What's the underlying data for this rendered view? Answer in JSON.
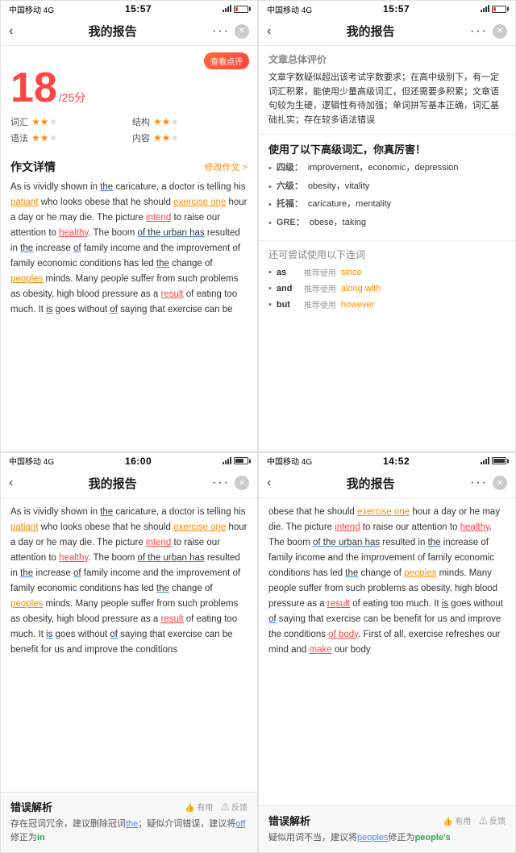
{
  "panels": [
    {
      "id": "top-left",
      "statusBar": {
        "carrier": "中国移动 4G",
        "time": "15:57",
        "battery": "low"
      },
      "navTitle": "我的报告",
      "reviewBtn": "查看点评",
      "score": {
        "number": "18",
        "total": "/25分",
        "items": [
          {
            "label": "词汇",
            "stars": 2,
            "max": 3
          },
          {
            "label": "结构",
            "stars": 2,
            "max": 3
          },
          {
            "label": "语法",
            "stars": 2,
            "max": 3
          },
          {
            "label": "内容",
            "stars": 2,
            "max": 3
          }
        ]
      },
      "essayTitle": "作文详情",
      "essayLink": "修改作文 >",
      "essayText": [
        {
          "text": "As is vividly shown in ",
          "style": "normal"
        },
        {
          "text": "the",
          "style": "underline-blue"
        },
        {
          "text": " caricature, a doctor is telling his ",
          "style": "normal"
        },
        {
          "text": "patiant",
          "style": "underline-orange"
        },
        {
          "text": " who looks obese that he should ",
          "style": "normal"
        },
        {
          "text": "exercise one",
          "style": "underline-orange"
        },
        {
          "text": " hour a day or he may die. The picture ",
          "style": "normal"
        },
        {
          "text": "intend",
          "style": "underline-red"
        },
        {
          "text": " to raise our attention to ",
          "style": "normal"
        },
        {
          "text": "healthy",
          "style": "underline-red"
        },
        {
          "text": ". The boom ",
          "style": "normal"
        },
        {
          "text": "of the urban has",
          "style": "underline-blue"
        },
        {
          "text": " resulted in ",
          "style": "normal"
        },
        {
          "text": "the",
          "style": "underline-blue"
        },
        {
          "text": " increase ",
          "style": "normal"
        },
        {
          "text": "of",
          "style": "underline-blue"
        },
        {
          "text": " family income and the improvement of family economic conditions has led ",
          "style": "normal"
        },
        {
          "text": "the",
          "style": "underline-blue"
        },
        {
          "text": " change of ",
          "style": "normal"
        },
        {
          "text": "peoples",
          "style": "underline-orange"
        },
        {
          "text": " minds. Many people suffer from such problems as obesity, high blood pressure as a ",
          "style": "normal"
        },
        {
          "text": "result",
          "style": "underline-red"
        },
        {
          "text": " of eating too much. It ",
          "style": "normal"
        },
        {
          "text": "is",
          "style": "underline-blue"
        },
        {
          "text": " goes without ",
          "style": "normal"
        },
        {
          "text": "of",
          "style": "underline-blue"
        },
        {
          "text": " saying that exercise can be",
          "style": "normal"
        }
      ]
    },
    {
      "id": "top-right",
      "statusBar": {
        "carrier": "中国移动 4G",
        "time": "15:57",
        "battery": "low"
      },
      "navTitle": "我的报告",
      "evalTitle": "文章总体评价",
      "evalText": "文章字数疑似超出该考试字数要求；在高中级别下，有一定词汇积累，能使用少量高级词汇，但还需要多积累；文章语句较为生硬，逻辑性有待加强；单词拼写基本正确，词汇基础扎实；存在较多语法错误",
      "vocabTitle": "使用了以下高级词汇，你真厉害！",
      "vocabItems": [
        {
          "level": "四级：",
          "words": "improvement，economic，depression"
        },
        {
          "level": "六级：",
          "words": "obesity，vitality"
        },
        {
          "level": "托福：",
          "words": "caricature，mentality"
        },
        {
          "level": "GRE：",
          "words": "obese，taking"
        }
      ],
      "conjTitle": "还可尝试使用以下连词",
      "conjItems": [
        {
          "word": "as",
          "label": "推荐使用",
          "suggest": "since"
        },
        {
          "word": "and",
          "label": "推荐使用",
          "suggest": "along with"
        },
        {
          "word": "but",
          "label": "推荐使用",
          "suggest": "however"
        }
      ]
    },
    {
      "id": "bottom-left",
      "statusBar": {
        "carrier": "中国移动 4G",
        "time": "16:00",
        "battery": "med"
      },
      "navTitle": "我的报告",
      "essayText": [
        {
          "text": "As is vividly shown in ",
          "style": "normal"
        },
        {
          "text": "the",
          "style": "underline-blue"
        },
        {
          "text": " caricature, a doctor is telling his ",
          "style": "normal"
        },
        {
          "text": "patiant",
          "style": "underline-orange"
        },
        {
          "text": " who looks obese that he should ",
          "style": "normal"
        },
        {
          "text": "exercise one",
          "style": "underline-orange"
        },
        {
          "text": " hour a day or he may die. The picture ",
          "style": "normal"
        },
        {
          "text": "intend",
          "style": "underline-red"
        },
        {
          "text": " to raise our attention to ",
          "style": "normal"
        },
        {
          "text": "healthy",
          "style": "underline-red"
        },
        {
          "text": ". The boom ",
          "style": "normal"
        },
        {
          "text": "of the urban has",
          "style": "underline-blue"
        },
        {
          "text": " resulted in ",
          "style": "normal"
        },
        {
          "text": "the",
          "style": "underline-blue"
        },
        {
          "text": " increase ",
          "style": "normal"
        },
        {
          "text": "of",
          "style": "underline-blue"
        },
        {
          "text": " family income and the improvement of family economic conditions has led ",
          "style": "normal"
        },
        {
          "text": "the",
          "style": "underline-blue"
        },
        {
          "text": " change of ",
          "style": "normal"
        },
        {
          "text": "peoples",
          "style": "underline-orange"
        },
        {
          "text": " minds. Many people suffer from such problems as obesity, high blood pressure as a ",
          "style": "normal"
        },
        {
          "text": "result",
          "style": "underline-red"
        },
        {
          "text": " of eating too much. It ",
          "style": "normal"
        },
        {
          "text": "is",
          "style": "underline-blue"
        },
        {
          "text": " goes without ",
          "style": "normal"
        },
        {
          "text": "of",
          "style": "underline-blue"
        },
        {
          "text": " saying that exercise can be benefit for us and improve the conditions",
          "style": "normal"
        }
      ],
      "errorTitle": "错误解析",
      "errorActions": [
        "👍 有用",
        "⚠ 反馈"
      ],
      "errorText": "存在冠词冗余，建议删除冠词the；疑似介词错误，建议将off修正为in"
    },
    {
      "id": "bottom-right",
      "statusBar": {
        "carrier": "中国移动 4G",
        "time": "14:52",
        "battery": "full"
      },
      "navTitle": "我的报告",
      "essayText": [
        {
          "text": "obese that he should ",
          "style": "normal"
        },
        {
          "text": "exercise one",
          "style": "underline-orange"
        },
        {
          "text": " hour a day or he may die. The picture ",
          "style": "normal"
        },
        {
          "text": "intend",
          "style": "underline-red"
        },
        {
          "text": " to raise our attention to ",
          "style": "normal"
        },
        {
          "text": "healthy",
          "style": "underline-red"
        },
        {
          "text": ". The boom ",
          "style": "normal"
        },
        {
          "text": "of the urban has",
          "style": "underline-blue"
        },
        {
          "text": " resulted in ",
          "style": "normal"
        },
        {
          "text": "the",
          "style": "underline-blue"
        },
        {
          "text": " increase of family income and the improvement of family economic conditions has led ",
          "style": "normal"
        },
        {
          "text": "the",
          "style": "underline-blue"
        },
        {
          "text": " change of ",
          "style": "normal"
        },
        {
          "text": "peoples",
          "style": "underline-orange"
        },
        {
          "text": " minds. Many people suffer from such problems as obesity, high blood pressure as a ",
          "style": "normal"
        },
        {
          "text": "result",
          "style": "underline-red"
        },
        {
          "text": " of eating too much. It ",
          "style": "normal"
        },
        {
          "text": "is",
          "style": "underline-blue"
        },
        {
          "text": " goes without ",
          "style": "normal"
        },
        {
          "text": "of",
          "style": "underline-blue"
        },
        {
          "text": " saying that exercise can be benefit for us and improve the conditions ",
          "style": "normal"
        },
        {
          "text": "of body",
          "style": "underline-red"
        },
        {
          "text": ". First of all, exercise refreshes our mind and ",
          "style": "normal"
        },
        {
          "text": "make",
          "style": "underline-red"
        },
        {
          "text": " our body",
          "style": "normal"
        }
      ],
      "errorTitle": "错误解析",
      "errorActions": [
        "👍 有用",
        "⚠ 反馈"
      ],
      "errorText": "疑似用词不当，建议将peoples修正为people's"
    }
  ]
}
